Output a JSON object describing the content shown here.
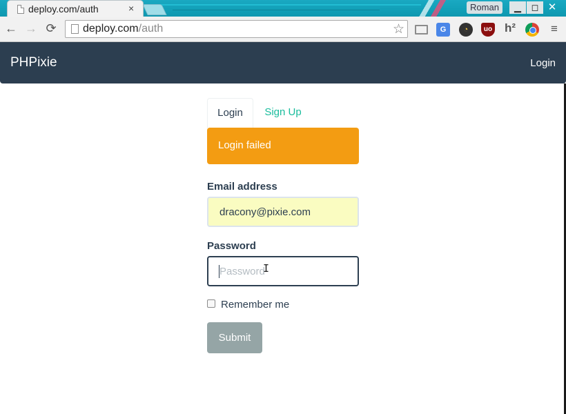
{
  "browser": {
    "tab_title": "deploy.com/auth",
    "tab_close": "×",
    "profile_name": "Roman",
    "window_buttons": {
      "minimize": "▁",
      "maximize": "◻",
      "close": "✕"
    },
    "nav": {
      "back": "←",
      "forward": "→",
      "reload": "⟳"
    },
    "url_host": "deploy.com",
    "url_path": "/auth",
    "bookmark_star": "☆",
    "extensions": {
      "cast": "",
      "translate": "G",
      "dial": "◔",
      "ublock": "uo",
      "h2": "h²",
      "chrome_icon": "",
      "menu": "≡"
    }
  },
  "site": {
    "brand": "PHPixie",
    "nav_login": "Login"
  },
  "auth": {
    "tabs": [
      {
        "label": "Login",
        "active": true
      },
      {
        "label": "Sign Up",
        "active": false
      }
    ],
    "alert": "Login failed",
    "email_label": "Email address",
    "email_value": "dracony@pixie.com",
    "password_label": "Password",
    "password_placeholder": "Password",
    "password_value": "",
    "remember_label": "Remember me",
    "remember_checked": false,
    "submit_label": "Submit"
  },
  "colors": {
    "navbar": "#2c3e50",
    "accent": "#18bc9c",
    "warning": "#f39c12",
    "autofill": "#fafcc1",
    "submit": "#95a5a6"
  }
}
